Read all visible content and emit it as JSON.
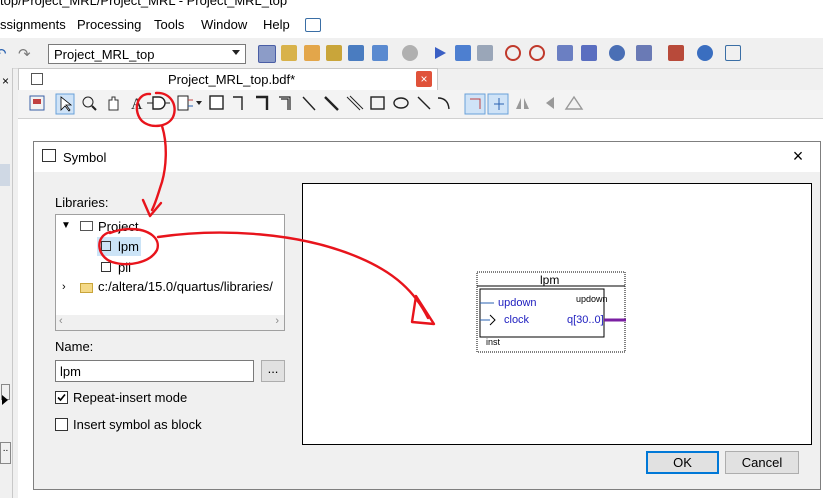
{
  "window": {
    "title": "top/Project_MRL/Project_MRL - Project_MRL_top"
  },
  "menubar": {
    "items": [
      "ssignments",
      "Processing",
      "Tools",
      "Window",
      "Help"
    ]
  },
  "toolbar": {
    "project_select": "Project_MRL_top"
  },
  "document_tab": {
    "title": "Project_MRL_top.bdf*",
    "close_glyph": "×"
  },
  "dialog": {
    "title": "Symbol",
    "close_glyph": "×",
    "libraries_label": "Libraries:",
    "tree": {
      "project_node": "Project",
      "lpm_item": "lpm",
      "pll_item": "pll",
      "quartus_path": "c:/altera/15.0/quartus/libraries/"
    },
    "name_label": "Name:",
    "name_value": "lpm",
    "browse_label": "...",
    "repeat_insert": {
      "label": "Repeat-insert mode",
      "checked": true
    },
    "insert_as_block": {
      "label": "Insert symbol as block",
      "checked": false
    },
    "ok_label": "OK",
    "cancel_label": "Cancel"
  },
  "preview_symbol": {
    "name": "lpm",
    "port_updown_in": "updown",
    "port_clock": "clock",
    "port_updown_out": "updown",
    "port_q": "q[30..0]",
    "instance": "inst"
  },
  "colors": {
    "annotation": "#e8141c",
    "accent": "#0078d7",
    "port_text": "#2020c0",
    "bus": "#7a1fa2"
  }
}
